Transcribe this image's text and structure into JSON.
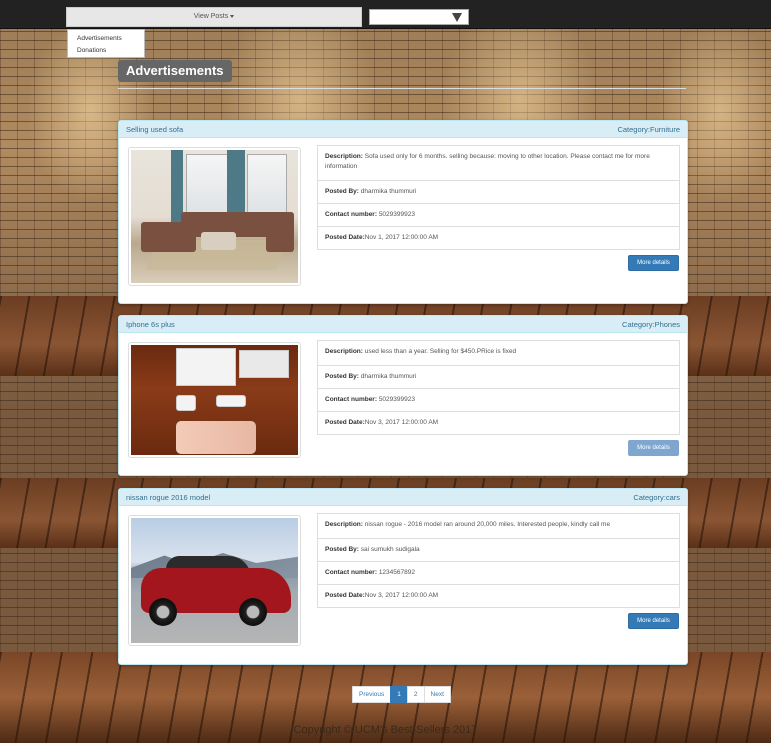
{
  "nav": {
    "dropdown_label": "View Posts",
    "menu_items": [
      "Advertisements",
      "Donations"
    ],
    "select_value": ""
  },
  "page": {
    "title": "Advertisements"
  },
  "posts": [
    {
      "title": "Selling used sofa",
      "category": "Category:Furniture",
      "description_label": "Description:",
      "description": "Sofa used only for 6 months. selling because: moving to other location. Please contact me for more information",
      "posted_by_label": "Posted By:",
      "posted_by": "dharmika thummuri",
      "contact_label": "Contact number:",
      "contact": "5029399923",
      "date_label": "Posted Date:",
      "date": "Nov 1, 2017 12:00:00 AM",
      "button": "More details"
    },
    {
      "title": "Iphone 6s plus",
      "category": "Category:Phones",
      "description_label": "Description:",
      "description": "used less than a year. Selling for $450.PRice is fixed",
      "posted_by_label": "Posted By:",
      "posted_by": "dharmika thummuri",
      "contact_label": "Contact number:",
      "contact": "5029399923",
      "date_label": "Posted Date:",
      "date": "Nov 3, 2017 12:00:00 AM",
      "button": "More details"
    },
    {
      "title": "nissan rogue 2016 model",
      "category": "Category:cars",
      "description_label": "Description:",
      "description": "nissan rogue - 2016 model ran around 20,000 miles. Interested people, kindly call me",
      "posted_by_label": "Posted By:",
      "posted_by": "sai sumukh sudigala",
      "contact_label": "Contact number:",
      "contact": "1234567892",
      "date_label": "Posted Date:",
      "date": "Nov 3, 2017 12:00:00 AM",
      "button": "More details"
    }
  ],
  "pagination": {
    "previous": "Previous",
    "pages": [
      "1",
      "2"
    ],
    "active": "1",
    "next": "Next"
  },
  "footer": "Copyright © UCM's Best-Sellers 2017",
  "colors": {
    "primary": "#337ab7",
    "panel_heading": "#d9edf7",
    "panel_heading_text": "#31708f",
    "topbar": "#222222"
  }
}
